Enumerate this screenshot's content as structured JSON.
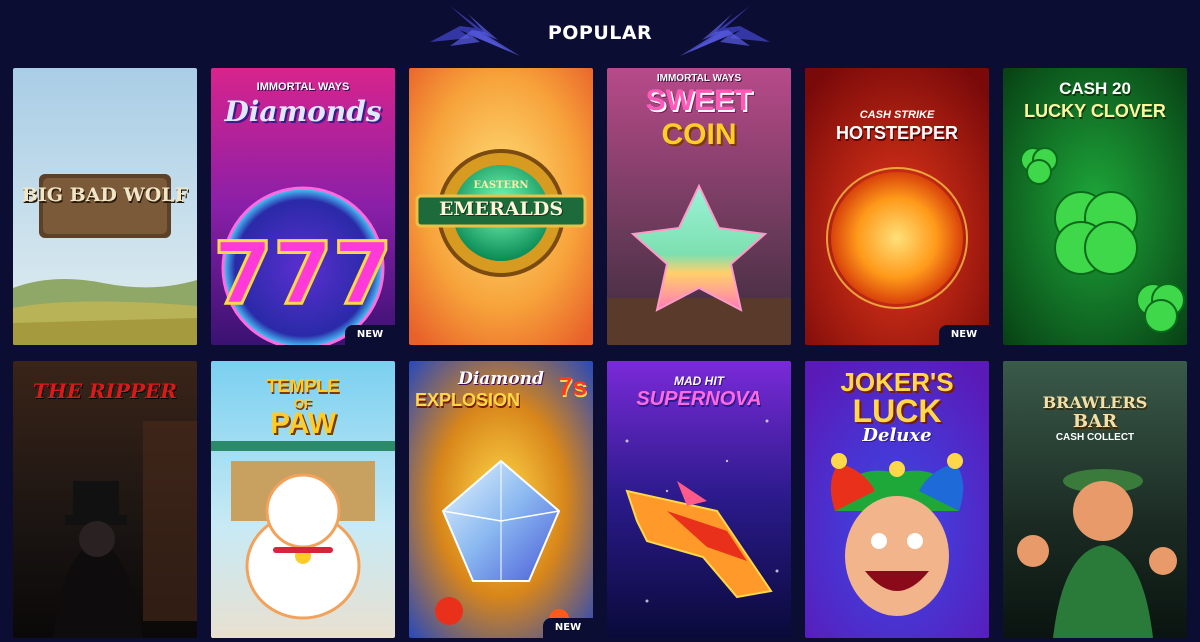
{
  "section": {
    "title": "POPULAR"
  },
  "badge_new_label": "NEW",
  "games": [
    {
      "title": "BIG BAD WOLF"
    },
    {
      "title_top": "IMMORTAL WAYS",
      "title_main": "Diamonds",
      "badge": "NEW"
    },
    {
      "title_top": "EASTERN",
      "title_main": "EMERALDS"
    },
    {
      "title_top": "IMMORTAL WAYS",
      "title_main": "SWEET",
      "title_sub": "COIN"
    },
    {
      "title_top": "CASH STRIKE",
      "title_main": "HOTSTEPPER",
      "badge": "NEW"
    },
    {
      "title_top": "CASH 20",
      "title_main": "LUCKY CLOVER"
    },
    {
      "title": "THE RIPPER"
    },
    {
      "title_top": "TEMPLE",
      "title_main": "OF",
      "title_sub": "PAW"
    },
    {
      "title_top": "Diamond",
      "title_main": "EXPLOSION",
      "title_sub": "7s",
      "badge": "NEW"
    },
    {
      "title_top": "MAD HIT",
      "title_main": "SUPERNOVA"
    },
    {
      "title_top": "JOKER'S",
      "title_main": "LUCK",
      "title_sub": "Deluxe"
    },
    {
      "title_top": "BRAWLERS",
      "title_main": "BAR",
      "title_sub": "CASH COLLECT"
    }
  ]
}
